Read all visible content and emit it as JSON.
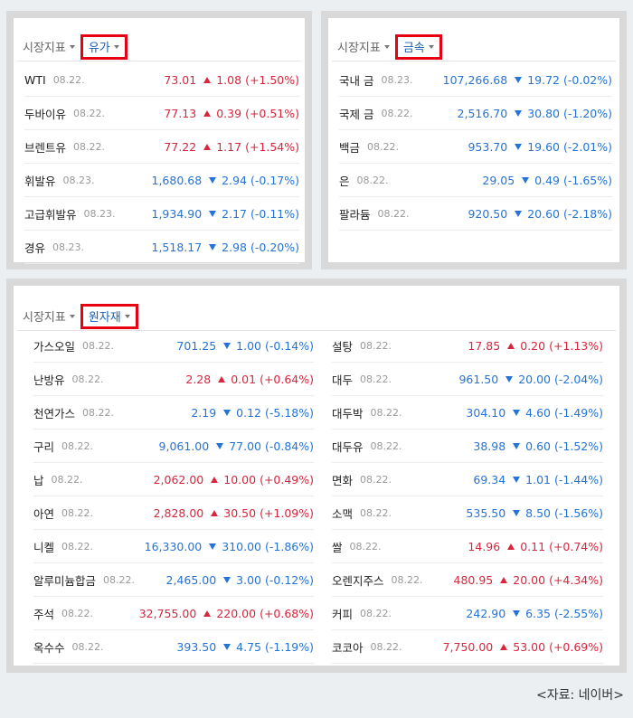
{
  "oil": {
    "tabs": [
      {
        "label": "시장지표",
        "active": false
      },
      {
        "label": "유가",
        "active": true
      }
    ],
    "rows": [
      {
        "name": "WTI",
        "date": "08.22.",
        "value": "73.01",
        "change": "1.08",
        "pct": "(+1.50%)",
        "dir": "up"
      },
      {
        "name": "두바이유",
        "date": "08.22.",
        "value": "77.13",
        "change": "0.39",
        "pct": "(+0.51%)",
        "dir": "up"
      },
      {
        "name": "브렌트유",
        "date": "08.22.",
        "value": "77.22",
        "change": "1.17",
        "pct": "(+1.54%)",
        "dir": "up"
      },
      {
        "name": "휘발유",
        "date": "08.23.",
        "value": "1,680.68",
        "change": "2.94",
        "pct": "(-0.17%)",
        "dir": "down"
      },
      {
        "name": "고급휘발유",
        "date": "08.23.",
        "value": "1,934.90",
        "change": "2.17",
        "pct": "(-0.11%)",
        "dir": "down"
      },
      {
        "name": "경유",
        "date": "08.23.",
        "value": "1,518.17",
        "change": "2.98",
        "pct": "(-0.20%)",
        "dir": "down"
      }
    ]
  },
  "metal": {
    "tabs": [
      {
        "label": "시장지표",
        "active": false
      },
      {
        "label": "금속",
        "active": true
      }
    ],
    "rows": [
      {
        "name": "국내 금",
        "date": "08.23.",
        "value": "107,266.68",
        "change": "19.72",
        "pct": "(-0.02%)",
        "dir": "down"
      },
      {
        "name": "국제 금",
        "date": "08.22.",
        "value": "2,516.70",
        "change": "30.80",
        "pct": "(-1.20%)",
        "dir": "down"
      },
      {
        "name": "백금",
        "date": "08.22.",
        "value": "953.70",
        "change": "19.60",
        "pct": "(-2.01%)",
        "dir": "down"
      },
      {
        "name": "은",
        "date": "08.22.",
        "value": "29.05",
        "change": "0.49",
        "pct": "(-1.65%)",
        "dir": "down"
      },
      {
        "name": "팔라듐",
        "date": "08.22.",
        "value": "920.50",
        "change": "20.60",
        "pct": "(-2.18%)",
        "dir": "down"
      }
    ]
  },
  "raw": {
    "tabs": [
      {
        "label": "시장지표",
        "active": false
      },
      {
        "label": "원자재",
        "active": true
      }
    ],
    "left": [
      {
        "name": "가스오일",
        "date": "08.22.",
        "value": "701.25",
        "change": "1.00",
        "pct": "(-0.14%)",
        "dir": "down"
      },
      {
        "name": "난방유",
        "date": "08.22.",
        "value": "2.28",
        "change": "0.01",
        "pct": "(+0.64%)",
        "dir": "up"
      },
      {
        "name": "천연가스",
        "date": "08.22.",
        "value": "2.19",
        "change": "0.12",
        "pct": "(-5.18%)",
        "dir": "down"
      },
      {
        "name": "구리",
        "date": "08.22.",
        "value": "9,061.00",
        "change": "77.00",
        "pct": "(-0.84%)",
        "dir": "down"
      },
      {
        "name": "납",
        "date": "08.22.",
        "value": "2,062.00",
        "change": "10.00",
        "pct": "(+0.49%)",
        "dir": "up"
      },
      {
        "name": "아연",
        "date": "08.22.",
        "value": "2,828.00",
        "change": "30.50",
        "pct": "(+1.09%)",
        "dir": "up"
      },
      {
        "name": "니켈",
        "date": "08.22.",
        "value": "16,330.00",
        "change": "310.00",
        "pct": "(-1.86%)",
        "dir": "down"
      },
      {
        "name": "알루미늄합금",
        "date": "08.22.",
        "value": "2,465.00",
        "change": "3.00",
        "pct": "(-0.12%)",
        "dir": "down"
      },
      {
        "name": "주석",
        "date": "08.22.",
        "value": "32,755.00",
        "change": "220.00",
        "pct": "(+0.68%)",
        "dir": "up"
      },
      {
        "name": "옥수수",
        "date": "08.22.",
        "value": "393.50",
        "change": "4.75",
        "pct": "(-1.19%)",
        "dir": "down"
      }
    ],
    "right": [
      {
        "name": "설탕",
        "date": "08.22.",
        "value": "17.85",
        "change": "0.20",
        "pct": "(+1.13%)",
        "dir": "up"
      },
      {
        "name": "대두",
        "date": "08.22.",
        "value": "961.50",
        "change": "20.00",
        "pct": "(-2.04%)",
        "dir": "down"
      },
      {
        "name": "대두박",
        "date": "08.22.",
        "value": "304.10",
        "change": "4.60",
        "pct": "(-1.49%)",
        "dir": "down"
      },
      {
        "name": "대두유",
        "date": "08.22.",
        "value": "38.98",
        "change": "0.60",
        "pct": "(-1.52%)",
        "dir": "down"
      },
      {
        "name": "면화",
        "date": "08.22.",
        "value": "69.34",
        "change": "1.01",
        "pct": "(-1.44%)",
        "dir": "down"
      },
      {
        "name": "소맥",
        "date": "08.22.",
        "value": "535.50",
        "change": "8.50",
        "pct": "(-1.56%)",
        "dir": "down"
      },
      {
        "name": "쌀",
        "date": "08.22.",
        "value": "14.96",
        "change": "0.11",
        "pct": "(+0.74%)",
        "dir": "up"
      },
      {
        "name": "오렌지주스",
        "date": "08.22.",
        "value": "480.95",
        "change": "20.00",
        "pct": "(+4.34%)",
        "dir": "up"
      },
      {
        "name": "커피",
        "date": "08.22.",
        "value": "242.90",
        "change": "6.35",
        "pct": "(-2.55%)",
        "dir": "down"
      },
      {
        "name": "코코아",
        "date": "08.22.",
        "value": "7,750.00",
        "change": "53.00",
        "pct": "(+0.69%)",
        "dir": "up"
      }
    ]
  },
  "source": "<자료: 네이버>",
  "colors": {
    "up": "#d7263d",
    "down": "#2474d8",
    "highlight": "#e60012"
  }
}
